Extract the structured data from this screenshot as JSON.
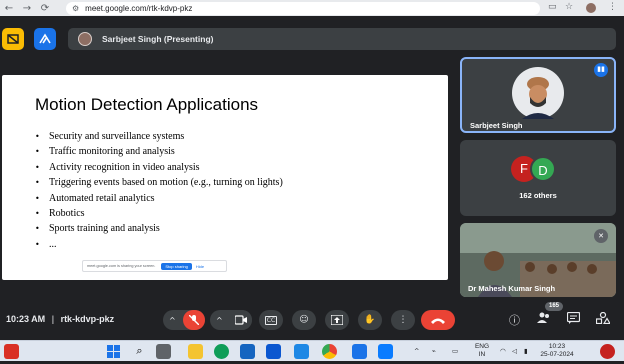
{
  "browser": {
    "url": "meet.google.com/rtk-kdvp-pkz",
    "back_glyph": "←",
    "forward_glyph": "→",
    "reload_glyph": "⟳"
  },
  "meet": {
    "presenter_label": "Sarbjeet Singh (Presenting)",
    "slide": {
      "title": "Motion Detection Applications",
      "bullets": [
        "Security and surveillance systems",
        "Traffic monitoring and analysis",
        "Activity recognition in video analysis",
        "Triggering events based on motion (e.g., turning on lights)",
        "Automated retail analytics",
        "Robotics",
        "Sports training and analysis",
        "..."
      ],
      "share_notice": "meet.google.com is sharing your screen.",
      "stop_sharing": "Stop sharing",
      "hide": "Hide"
    },
    "tiles": {
      "presenter_name": "Sarbjeet Singh",
      "others_label": "162 others",
      "avatar_f": "F",
      "avatar_d": "D",
      "camera_name": "Dr Mahesh Kumar Singh"
    },
    "bottom": {
      "time": "10:23 AM",
      "separator": "|",
      "meeting_code": "rtk-kdvp-pkz",
      "participant_count": "165"
    },
    "colors": {
      "accent": "#1a73e8",
      "mic_off": "#ea4335",
      "end_call": "#ea4335",
      "avatar_f": "#c5221f",
      "avatar_d": "#34a853"
    }
  },
  "taskbar": {
    "lang_top": "ENG",
    "lang_bottom": "IN",
    "time": "10:23",
    "date": "25-07-2024"
  }
}
